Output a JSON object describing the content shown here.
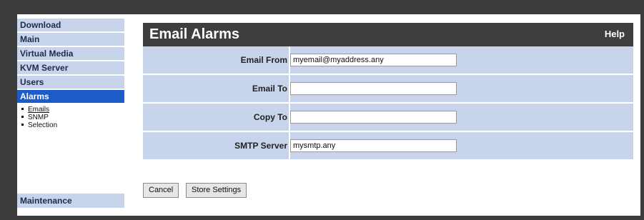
{
  "sidebar": {
    "items": [
      {
        "label": "Download"
      },
      {
        "label": "Main"
      },
      {
        "label": "Virtual Media"
      },
      {
        "label": "KVM Server"
      },
      {
        "label": "Users"
      },
      {
        "label": "Alarms"
      }
    ],
    "submenu": [
      {
        "label": "Emails"
      },
      {
        "label": "SNMP"
      },
      {
        "label": "Selection"
      }
    ],
    "maintenance": "Maintenance"
  },
  "header": {
    "title": "Email Alarms",
    "help": "Help"
  },
  "form": {
    "rows": [
      {
        "label": "Email From",
        "value": "myemail@myaddress.any"
      },
      {
        "label": "Email To",
        "value": ""
      },
      {
        "label": "Copy To",
        "value": ""
      },
      {
        "label": "SMTP Server",
        "value": "mysmtp.any"
      }
    ]
  },
  "buttons": {
    "cancel": "Cancel",
    "store": "Store Settings"
  },
  "colors": {
    "accent": "#1c5cc8",
    "row_bg": "#c8d4ec",
    "title_bg": "#3e3e3e",
    "page_bg": "#3b3b3b"
  }
}
